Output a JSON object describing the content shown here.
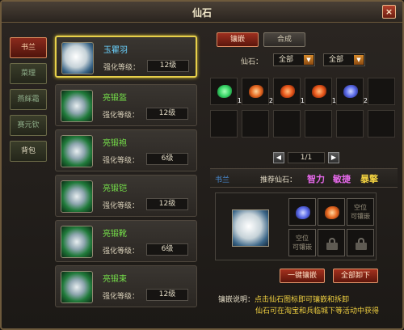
{
  "window": {
    "title": "仙石",
    "close_label": "×"
  },
  "side_tabs": [
    {
      "label": "书兰",
      "state": "active"
    },
    {
      "label": "菜理",
      "state": "normal"
    },
    {
      "label": "燕綵霜",
      "state": "normal"
    },
    {
      "label": "赛元钦",
      "state": "normal"
    },
    {
      "label": "背包",
      "state": "plain"
    }
  ],
  "items": [
    {
      "name": "玉瞿羽",
      "level_label": "强化等级：",
      "level": "12级",
      "icon": "white-feather-icon",
      "selected": true
    },
    {
      "name": "亮锻盔",
      "level_label": "强化等级：",
      "level": "12级",
      "icon": "helmet-icon",
      "selected": false
    },
    {
      "name": "亮锻袍",
      "level_label": "强化等级：",
      "level": "6级",
      "icon": "robe-icon",
      "selected": false
    },
    {
      "name": "亮锻铠",
      "level_label": "强化等级：",
      "level": "12级",
      "icon": "armor-icon",
      "selected": false
    },
    {
      "name": "亮锻靴",
      "level_label": "强化等级：",
      "level": "6级",
      "icon": "boots-icon",
      "selected": false
    },
    {
      "name": "亮锻束",
      "level_label": "强化等级：",
      "level": "12级",
      "icon": "belt-icon",
      "selected": false
    }
  ],
  "tabs": {
    "inlay": "镶嵌",
    "combine": "合成"
  },
  "filter": {
    "label": "仙石：",
    "select1": "全部",
    "select2": "全部"
  },
  "gems": [
    {
      "color": "#3ad86a",
      "count": "1"
    },
    {
      "color": "#e86a22",
      "count": "2"
    },
    {
      "color": "#e8561a",
      "count": "1"
    },
    {
      "color": "#e8561a",
      "count": "1"
    },
    {
      "color": "#5a6ae8",
      "count": "2"
    }
  ],
  "pager": {
    "text": "1/1",
    "prev": "◀",
    "next": "▶"
  },
  "recommend": {
    "name": "书兰",
    "label": "推荐仙石：",
    "attrs": [
      "智力",
      "敏捷",
      "暴擎"
    ]
  },
  "sockets": {
    "empty_text": "空位\n可镶嵌"
  },
  "buttons": {
    "inlay_all": "一键镶嵌",
    "remove_all": "全部卸下"
  },
  "description": {
    "label": "镶嵌说明：",
    "line1": "点击仙石图标即可镶嵌和拆卸",
    "line2": "仙石可在淘宝和兵临城下等活动中获得"
  }
}
